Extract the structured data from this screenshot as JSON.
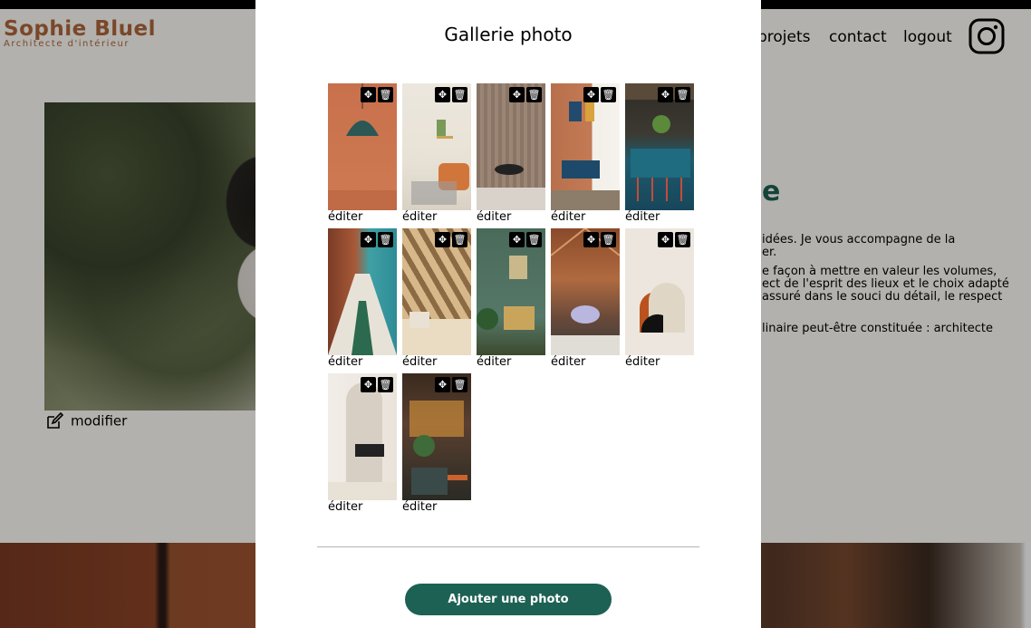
{
  "header": {
    "logo_name": "Sophie Bluel",
    "logo_subtitle": "Architecte d'intérieur",
    "nav": {
      "projets": "projets",
      "contact": "contact",
      "logout": "logout"
    }
  },
  "main": {
    "modifier_label": "modifier",
    "about_title_fragment": "e",
    "paragraphs": [
      "idées. Je vous accompagne de la\ner.",
      "e façon à mettre en valeur les volumes,\nect de l'esprit des lieux et le choix adapté\nassuré dans le souci du détail, le respect",
      "linaire peut-être constituée : architecte"
    ]
  },
  "modal": {
    "title": "Gallerie photo",
    "edit_label": "éditer",
    "move_icon": "move-icon",
    "trash_icon": "trash-icon",
    "add_button_label": "Ajouter une photo",
    "photos": [
      {
        "id": "p1",
        "caption": "éditer"
      },
      {
        "id": "p2",
        "caption": "éditer"
      },
      {
        "id": "p3",
        "caption": "éditer"
      },
      {
        "id": "p4",
        "caption": "éditer"
      },
      {
        "id": "p5",
        "caption": "éditer"
      },
      {
        "id": "p6",
        "caption": "éditer"
      },
      {
        "id": "p7",
        "caption": "éditer"
      },
      {
        "id": "p8",
        "caption": "éditer"
      },
      {
        "id": "p9",
        "caption": "éditer"
      },
      {
        "id": "p10",
        "caption": "éditer"
      },
      {
        "id": "p11",
        "caption": "éditer"
      },
      {
        "id": "p12",
        "caption": "éditer"
      }
    ]
  },
  "colors": {
    "accent": "#1d6154",
    "brand": "#b1663c"
  }
}
